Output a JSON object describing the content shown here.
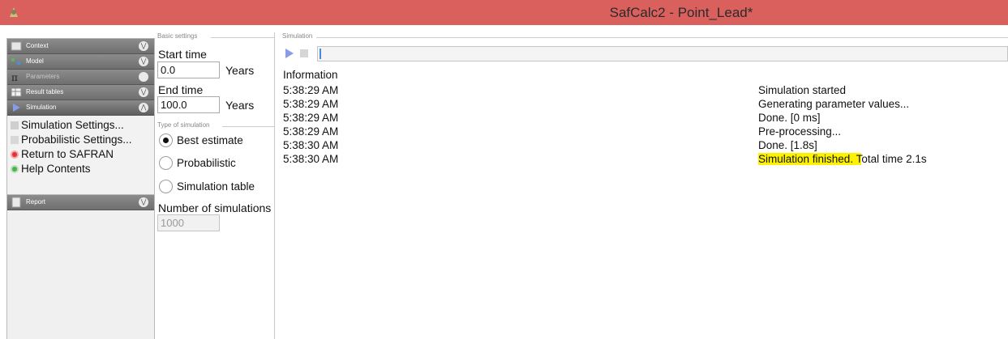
{
  "window": {
    "title": "SafCalc2 - Point_Lead*"
  },
  "sidebar": {
    "sections": [
      {
        "label": "Context",
        "icon": "context-icon"
      },
      {
        "label": "Model",
        "icon": "model-icon"
      },
      {
        "label": "Parameters",
        "icon": "pi-icon"
      },
      {
        "label": "Result tables",
        "icon": "table-icon"
      },
      {
        "label": "Simulation",
        "icon": "play-icon"
      }
    ],
    "simulation_items": [
      {
        "label": "Simulation Settings...",
        "icon": "settings-icon"
      },
      {
        "label": "Probabilistic Settings...",
        "icon": "probability-icon"
      },
      {
        "label": "Return to SAFRAN",
        "icon": "red-dot-icon"
      },
      {
        "label": "Help Contents",
        "icon": "green-dot-icon"
      }
    ],
    "report": {
      "label": "Report",
      "icon": "report-icon"
    }
  },
  "basic_settings": {
    "group_title": "Basic settings",
    "start_time_label": "Start time",
    "start_time_value": "0.0",
    "start_time_unit": "Years",
    "end_time_label": "End time",
    "end_time_value": "100.0",
    "end_time_unit": "Years"
  },
  "simulation_type": {
    "group_title": "Type of simulation",
    "options": [
      {
        "label": "Best estimate",
        "selected": true
      },
      {
        "label": "Probabilistic",
        "selected": false
      },
      {
        "label": "Simulation table",
        "selected": false
      }
    ],
    "num_simulations_label": "Number of simulations",
    "num_simulations_value": "1000"
  },
  "simulation_panel": {
    "group_title": "Simulation",
    "progress_fraction": 0,
    "info_title": "Information",
    "log": [
      {
        "time": "5:38:29 AM",
        "message": "Simulation started"
      },
      {
        "time": "5:38:29 AM",
        "message": "Generating parameter values..."
      },
      {
        "time": "5:38:29 AM",
        "message": "Done. [0 ms]"
      },
      {
        "time": "5:38:29 AM",
        "message": "Pre-processing..."
      },
      {
        "time": "5:38:30 AM",
        "message": "Done. [1.8s]"
      },
      {
        "time": "5:38:30 AM",
        "message_highlight": "Simulation finished. T",
        "message_rest": "otal time 2.1s"
      }
    ]
  },
  "colors": {
    "titlebar": "#d9605c",
    "highlight": "#fff200"
  }
}
